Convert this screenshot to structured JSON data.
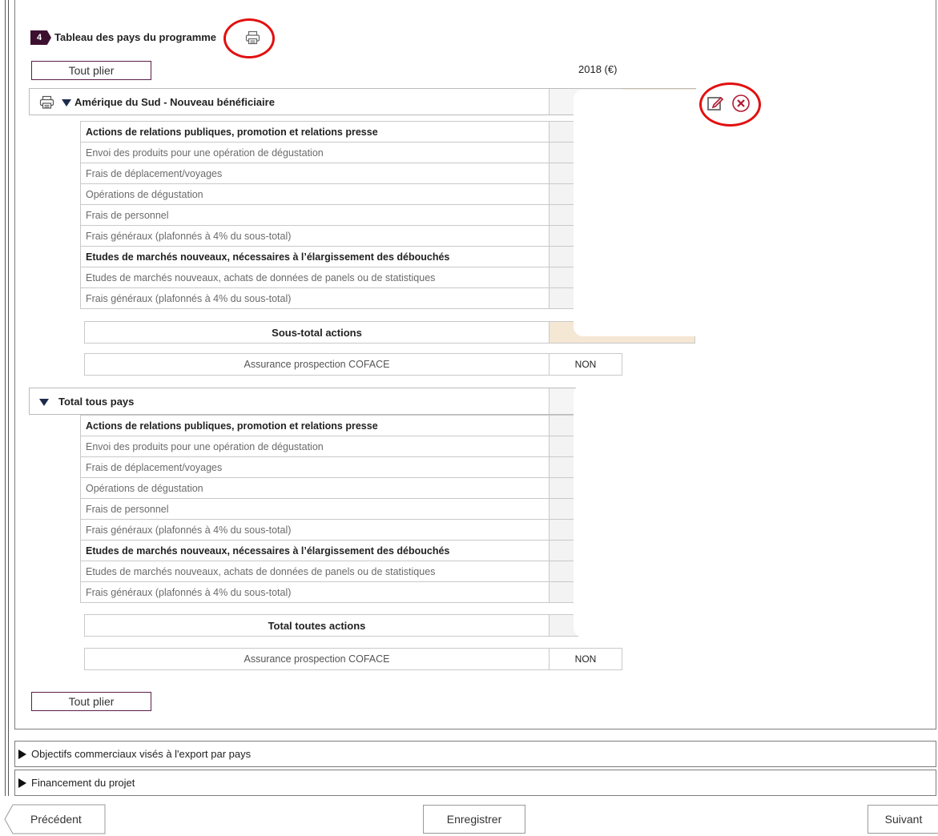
{
  "section": {
    "number": "4",
    "title": "Tableau des pays du programme"
  },
  "toolbar": {
    "fold_all_label": "Tout plier",
    "fold_all_bottom_label": "Tout plier"
  },
  "year_header": "2018 (€)",
  "groups": [
    {
      "title": "Amérique du Sud - Nouveau bénéficiaire",
      "rows": [
        {
          "label": "Actions de relations publiques, promotion et relations presse",
          "bold": true
        },
        {
          "label": "Envoi des produits pour une opération de dégustation",
          "bold": false
        },
        {
          "label": "Frais de déplacement/voyages",
          "bold": false
        },
        {
          "label": "Opérations de dégustation",
          "bold": false
        },
        {
          "label": "Frais de personnel",
          "bold": false
        },
        {
          "label": "Frais généraux (plafonnés à 4% du sous-total)",
          "bold": false
        },
        {
          "label": "Etudes de marchés nouveaux, nécessaires à l’élargissement des débouchés",
          "bold": true
        },
        {
          "label": "Etudes de marchés nouveaux, achats de données de panels ou de statistiques",
          "bold": false
        },
        {
          "label": "Frais généraux (plafonnés à 4% du sous-total)",
          "bold": false
        }
      ],
      "subtotal_label": "Sous-total actions",
      "coface_label": "Assurance prospection COFACE",
      "coface_value": "NON"
    },
    {
      "title": "Total tous pays",
      "rows": [
        {
          "label": "Actions de relations publiques, promotion et relations presse",
          "bold": true
        },
        {
          "label": "Envoi des produits pour une opération de dégustation",
          "bold": false
        },
        {
          "label": "Frais de déplacement/voyages",
          "bold": false
        },
        {
          "label": "Opérations de dégustation",
          "bold": false
        },
        {
          "label": "Frais de personnel",
          "bold": false
        },
        {
          "label": "Frais généraux (plafonnés à 4% du sous-total)",
          "bold": false
        },
        {
          "label": "Etudes de marchés nouveaux, nécessaires à l’élargissement des débouchés",
          "bold": true
        },
        {
          "label": "Etudes de marchés nouveaux, achats de données de panels ou de statistiques",
          "bold": false
        },
        {
          "label": "Frais généraux (plafonnés à 4% du sous-total)",
          "bold": false
        }
      ],
      "subtotal_label": "Total toutes actions",
      "coface_label": "Assurance prospection COFACE",
      "coface_value": "NON"
    }
  ],
  "accordion": [
    {
      "label": "Objectifs commerciaux visés à l'export par pays"
    },
    {
      "label": "Financement du projet"
    }
  ],
  "nav": {
    "previous_label": "Précédent",
    "save_label": "Enregistrer",
    "next_label": "Suivant"
  },
  "icons": {
    "section_print": "printer-icon",
    "group_print": "printer-icon",
    "expanded": "triangle-down-icon",
    "collapsed": "triangle-right-icon",
    "edit": "edit-icon",
    "delete": "close-circle-icon"
  },
  "colors": {
    "badge": "#3d1030",
    "button_border": "#5a1e48",
    "annotation": "#e21010",
    "subtotal_fill": "#f4e7d4",
    "delete_icon": "#b0192e"
  }
}
